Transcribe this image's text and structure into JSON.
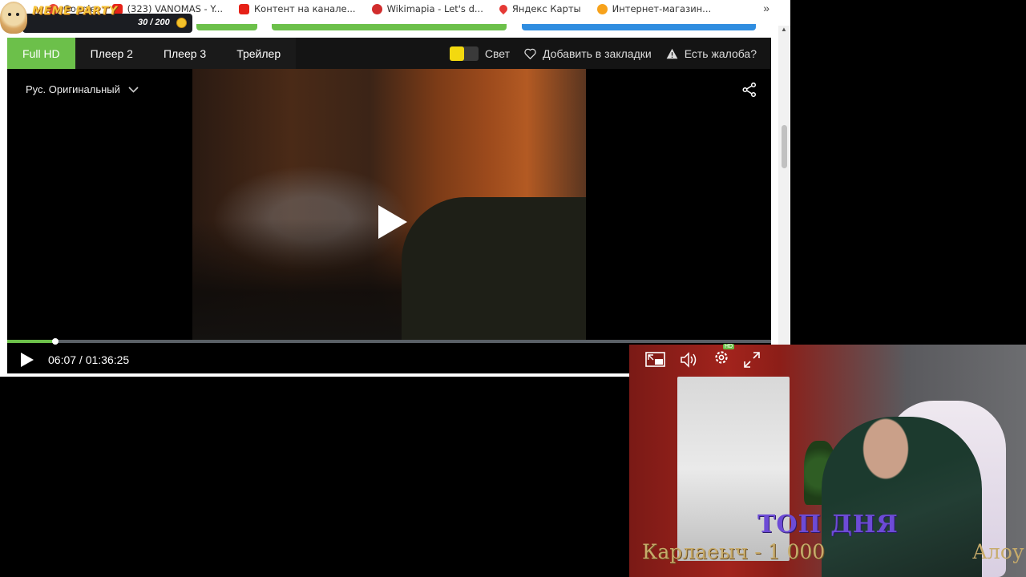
{
  "overlay": {
    "title": "MEME PARTY",
    "count": "30 / 200"
  },
  "bookmarks": [
    {
      "label": "Google",
      "icon": "google-icon",
      "color": "#ea4335"
    },
    {
      "label": "(323) VANOMAS - Y...",
      "icon": "youtube-icon",
      "color": "#e62117"
    },
    {
      "label": "Контент на канале...",
      "icon": "youtube-studio-icon",
      "color": "#e62117"
    },
    {
      "label": "Wikimapia - Let's d...",
      "icon": "wikimapia-icon",
      "color": "#d12d2d"
    },
    {
      "label": "Яндекс Карты",
      "icon": "map-pin-icon",
      "color": "#e53935"
    },
    {
      "label": "Интернет-магазин...",
      "icon": "shop-icon",
      "color": "#f7a21b"
    }
  ],
  "player": {
    "tabs": [
      {
        "label": "Full HD",
        "active": true
      },
      {
        "label": "Плеер 2",
        "active": false
      },
      {
        "label": "Плеер 3",
        "active": false
      },
      {
        "label": "Трейлер",
        "active": false
      }
    ],
    "light_label": "Свет",
    "bookmark_label": "Добавить в закладки",
    "report_label": "Есть жалоба?",
    "audio_track": "Рус. Оригинальный",
    "time_display": "06:07 / 01:36:25",
    "progress_fraction": 0.063,
    "hd_badge": "HD",
    "accent_color": "#6cc04a"
  },
  "webcam": {
    "title": "ТОП ДНЯ",
    "line": "Карлаеыч - 1 000",
    "line_right": "Алоу"
  }
}
